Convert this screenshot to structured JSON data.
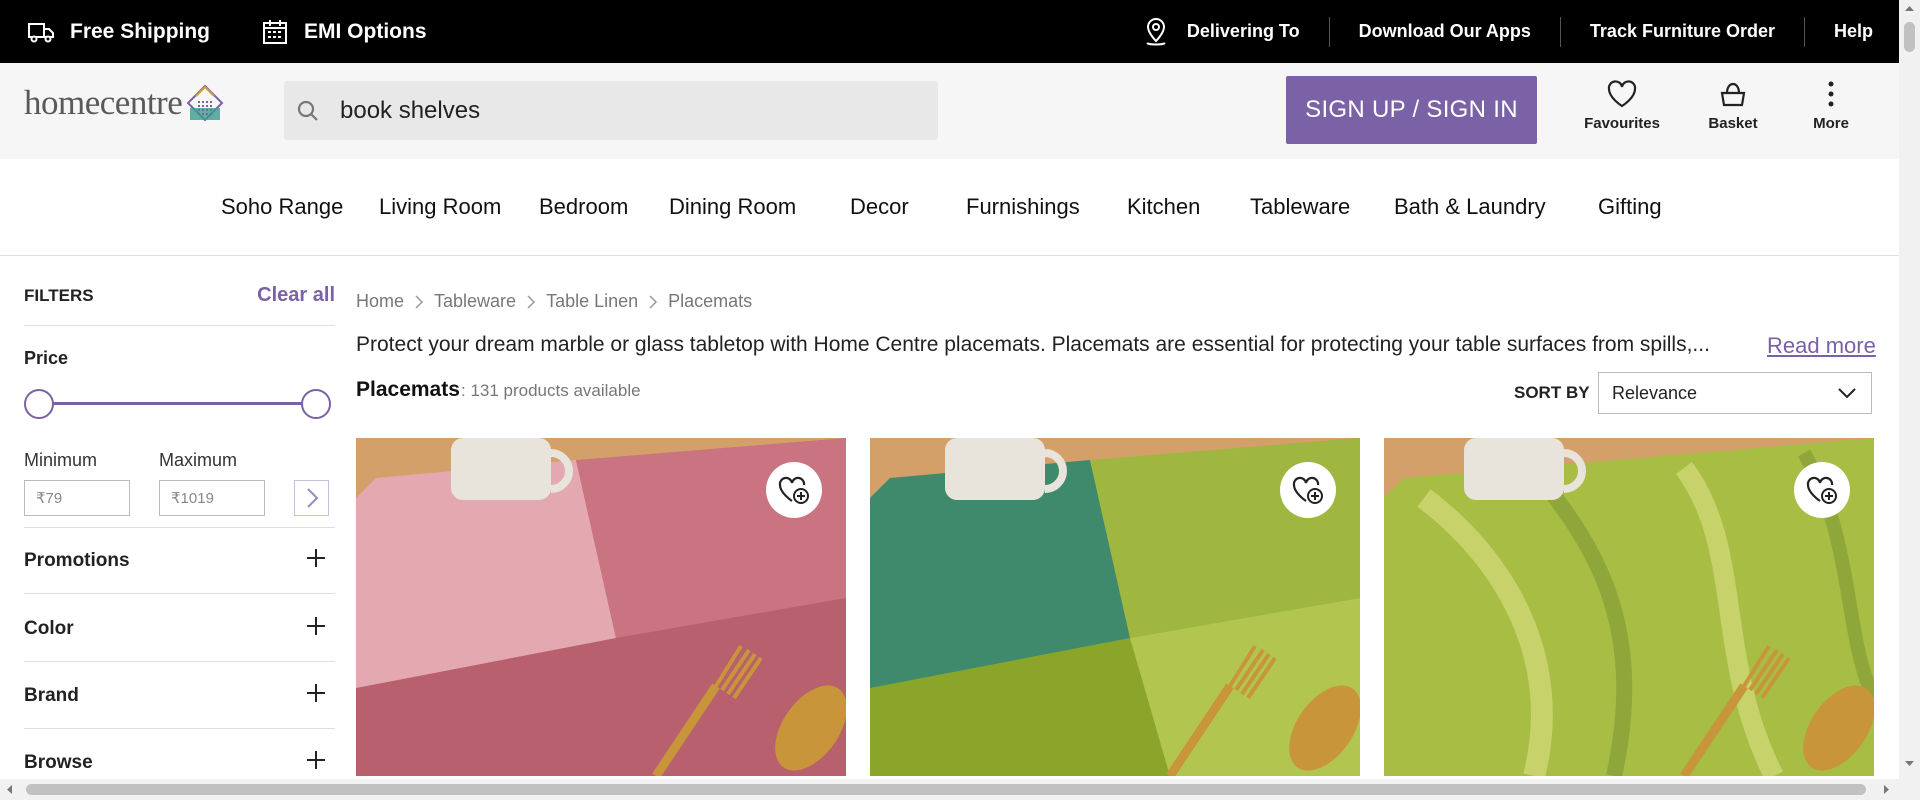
{
  "topbar": {
    "free_shipping": "Free Shipping",
    "emi_options": "EMI Options",
    "delivering_to": "Delivering To",
    "download_apps": "Download Our Apps",
    "track_order": "Track Furniture Order",
    "help": "Help"
  },
  "header": {
    "logo_text": "homecentre",
    "search_value": "book shelves",
    "signin_label": "SIGN UP / SIGN IN",
    "favourites": "Favourites",
    "basket": "Basket",
    "more": "More"
  },
  "nav": {
    "items": [
      "Soho Range",
      "Living Room",
      "Bedroom",
      "Dining Room",
      "Decor",
      "Furnishings",
      "Kitchen",
      "Tableware",
      "Bath & Laundry",
      "Gifting"
    ]
  },
  "filters": {
    "title": "FILTERS",
    "clear_all": "Clear all",
    "price_label": "Price",
    "min_label": "Minimum",
    "max_label": "Maximum",
    "min_placeholder": "₹79",
    "max_placeholder": "₹1019",
    "sections": [
      "Promotions",
      "Color",
      "Brand",
      "Browse"
    ]
  },
  "breadcrumb": [
    "Home",
    "Tableware",
    "Table Linen",
    "Placemats"
  ],
  "description": "Protect your dream marble or glass tabletop with Home Centre placemats. Placemats are essential for protecting your table surfaces from spills,...",
  "read_more": "Read more",
  "listing": {
    "title": "Placemats",
    "count": ": 131 products available",
    "sort_label": "SORT BY",
    "sort_value": "Relevance"
  },
  "colors": {
    "accent": "#7b61a5",
    "topbar": "#000000",
    "header_bg": "#f6f6f6"
  },
  "products": [
    {
      "mat_color": "#b9606e",
      "icon": "heart-plus-icon"
    },
    {
      "mat_color": "#8aa52a",
      "icon": "heart-plus-icon"
    },
    {
      "mat_color": "#9ab33c",
      "icon": "heart-plus-icon"
    }
  ]
}
